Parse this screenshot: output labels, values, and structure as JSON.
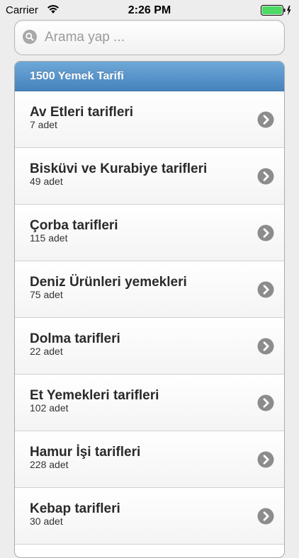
{
  "status_bar": {
    "carrier": "Carrier",
    "time": "2:26 PM"
  },
  "search": {
    "placeholder": "Arama yap ..."
  },
  "list": {
    "header": "1500 Yemek Tarifi",
    "items": [
      {
        "title": "Av Etleri tarifleri",
        "count": "7 adet"
      },
      {
        "title": "Bisküvi ve Kurabiye tarifleri",
        "count": "49 adet"
      },
      {
        "title": "Çorba tarifleri",
        "count": "115 adet"
      },
      {
        "title": "Deniz Ürünleri yemekleri",
        "count": "75 adet"
      },
      {
        "title": "Dolma tarifleri",
        "count": "22 adet"
      },
      {
        "title": "Et Yemekleri tarifleri",
        "count": "102 adet"
      },
      {
        "title": "Hamur İşi tarifleri",
        "count": "228 adet"
      },
      {
        "title": "Kebap tarifleri",
        "count": "30 adet"
      }
    ]
  },
  "colors": {
    "header_top": "#6ea8d8",
    "header_bottom": "#4683be",
    "chevron": "#8c8c8c",
    "battery": "#4cd964"
  }
}
